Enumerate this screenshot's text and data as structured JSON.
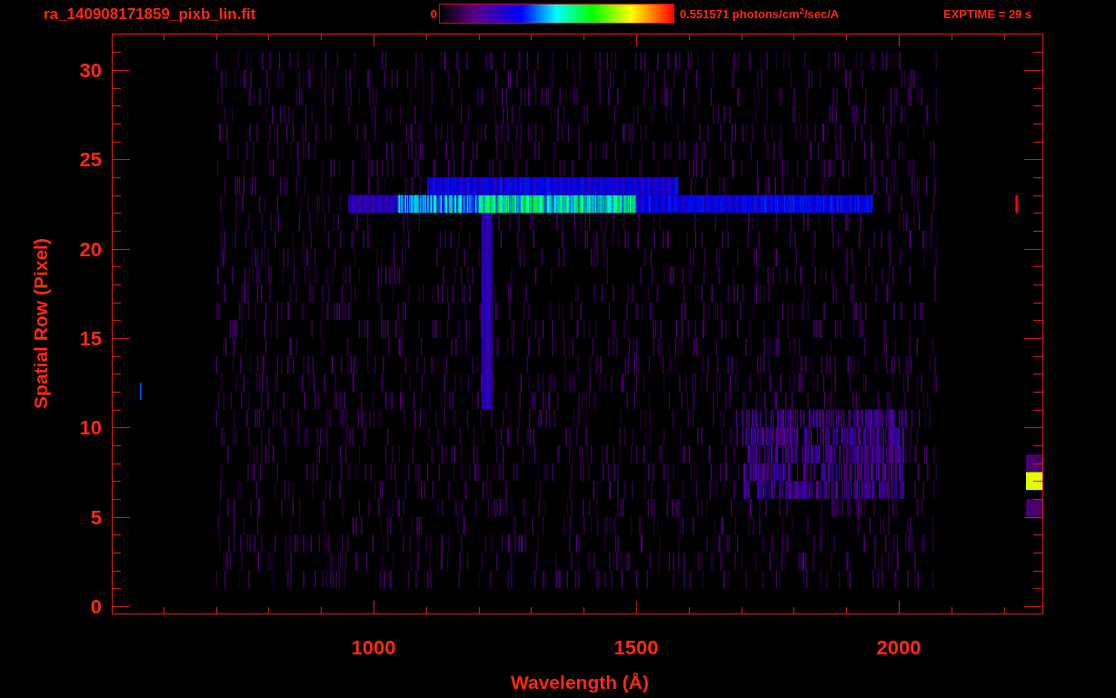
{
  "title": "ra_140908171859_pixb_lin.fit",
  "colorbar": {
    "min_label": "0",
    "max_label": "0.551571 photons/cm$^{2}$/sec/A"
  },
  "exptime": "EXPTIME = 29 s",
  "xaxis": {
    "label": "Wavelength (Å)",
    "ticks": [
      "1000",
      "1500",
      "2000"
    ]
  },
  "yaxis": {
    "label": "Spatial Row (Pixel)",
    "ticks": [
      "30",
      "25",
      "20",
      "15",
      "10",
      "5",
      "0"
    ]
  }
}
